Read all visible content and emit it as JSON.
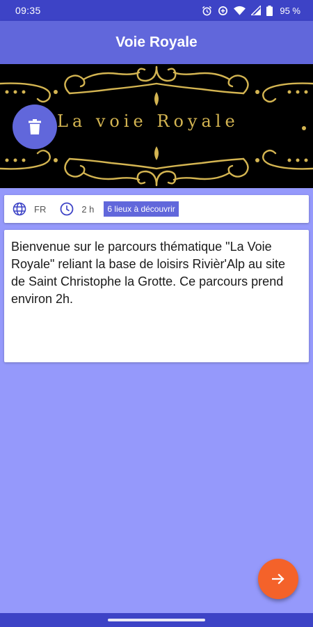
{
  "status_bar": {
    "time": "09:35",
    "battery": "95 %",
    "icons": [
      "alarm-icon",
      "data-saver-icon",
      "wifi-icon",
      "signal-icon",
      "battery-icon"
    ]
  },
  "app_bar": {
    "title": "Voie Royale"
  },
  "banner": {
    "title": "La voie Royale",
    "gold_color": "#d4b552"
  },
  "delete_button": {
    "icon": "trash-icon"
  },
  "info": {
    "language": "FR",
    "duration": "2 h",
    "places": "6 lieux à découvrir",
    "language_icon": "globe-icon",
    "duration_icon": "clock-icon"
  },
  "description": "Bienvenue sur le parcours thématique \"La Voie Royale\" reliant la base de loisirs Rivièr'Alp au site de Saint Christophe la Grotte. Ce parcours prend environ 2h.",
  "next_button": {
    "icon": "arrow-right-icon"
  },
  "colors": {
    "primary": "#6167db",
    "primary_dark": "#3d43c6",
    "background": "#9599fb",
    "accent": "#f4622a"
  }
}
